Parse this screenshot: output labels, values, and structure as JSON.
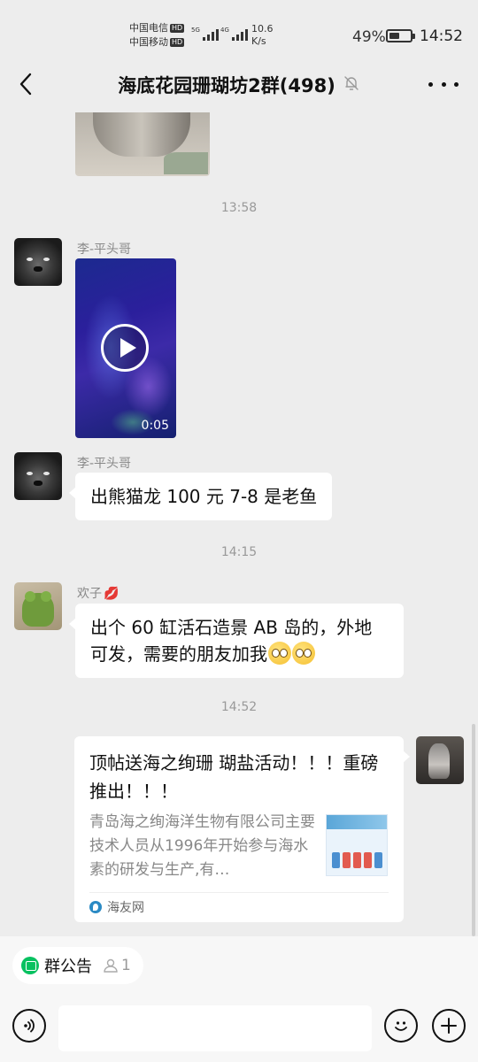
{
  "status": {
    "carrier1": "中国电信",
    "carrier2": "中国移动",
    "hd": "HD",
    "net1": "5G",
    "net2": "4G",
    "speed_value": "10.6",
    "speed_unit": "K/s",
    "battery": "49%",
    "battery_level": 0.49,
    "time": "14:52"
  },
  "header": {
    "title": "海底花园珊瑚坊2群(498)",
    "back_icon": "chevron-left-icon",
    "mute_icon": "bell-off-icon",
    "more_icon": "more-icon"
  },
  "messages": {
    "time1": "13:58",
    "sender1": "李-平头哥",
    "video_duration": "0:05",
    "sender2": "李-平头哥",
    "text2": "出熊猫龙 100 元 7-8 是老鱼",
    "time2": "14:15",
    "sender3": "欢子",
    "text3": "出个 60 缸活石造景 AB 岛的，外地可发，需要的朋友加我",
    "time3": "14:52",
    "card_title": "顶帖送海之绚珊 瑚盐活动！！！重磅推出！！！",
    "card_desc": "青岛海之绚海洋生物有限公司主要技术人员从1996年开始参与海水素的研发与生产,有…",
    "card_source": "海友网"
  },
  "bottom": {
    "notice_label": "群公告",
    "notice_count": "1",
    "voice_icon": "voice-icon",
    "emoji_icon": "emoji-icon",
    "plus_icon": "plus-icon"
  },
  "colors": {
    "background": "#ededed",
    "bubble": "#ffffff",
    "accent_green": "#07c160"
  }
}
